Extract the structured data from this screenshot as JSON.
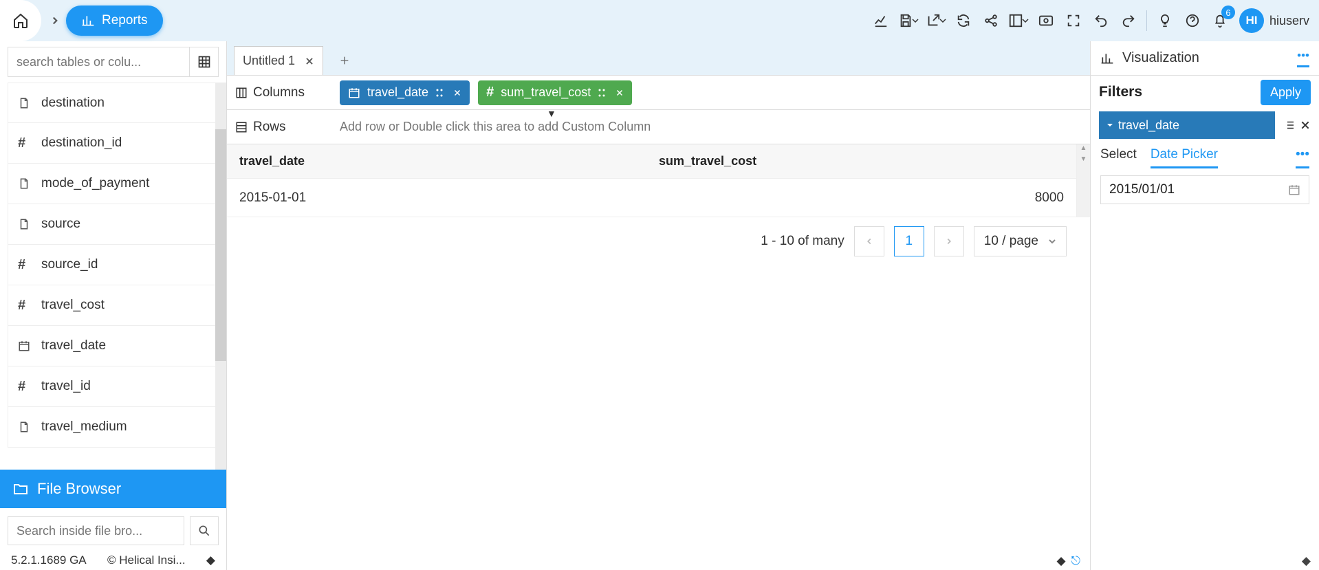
{
  "header": {
    "breadcrumb": "Reports",
    "notification_count": "6",
    "avatar_initials": "HI",
    "username": "hiuserv"
  },
  "sidebar": {
    "search_placeholder": "search tables or colu...",
    "fields": [
      {
        "icon": "doc",
        "name": "destination"
      },
      {
        "icon": "hash",
        "name": "destination_id"
      },
      {
        "icon": "doc",
        "name": "mode_of_payment"
      },
      {
        "icon": "doc",
        "name": "source"
      },
      {
        "icon": "hash",
        "name": "source_id"
      },
      {
        "icon": "hash",
        "name": "travel_cost"
      },
      {
        "icon": "calendar",
        "name": "travel_date"
      },
      {
        "icon": "hash",
        "name": "travel_id"
      },
      {
        "icon": "doc",
        "name": "travel_medium"
      }
    ],
    "file_browser_label": "File Browser",
    "file_search_placeholder": "Search inside file bro...",
    "version": "5.2.1.1689 GA",
    "copyright": "© Helical Insi..."
  },
  "main": {
    "tab_title": "Untitled 1",
    "columns_label": "Columns",
    "rows_label": "Rows",
    "rows_placeholder": "Add row or Double click this area to add Custom Column",
    "column_chips": [
      {
        "name": "travel_date",
        "color": "blue",
        "icon": "calendar"
      },
      {
        "name": "sum_travel_cost",
        "color": "green",
        "icon": "hash"
      }
    ],
    "table": {
      "headers": [
        "travel_date",
        "sum_travel_cost"
      ],
      "rows": [
        {
          "travel_date": "2015-01-01",
          "sum_travel_cost": "8000"
        }
      ]
    },
    "pager": {
      "range": "1 - 10 of many",
      "current": "1",
      "per_page": "10 / page"
    }
  },
  "right": {
    "viz_label": "Visualization",
    "filters_label": "Filters",
    "apply_label": "Apply",
    "filter_field": "travel_date",
    "mode_select": "Select",
    "mode_picker": "Date Picker",
    "date_value": "2015/01/01"
  }
}
